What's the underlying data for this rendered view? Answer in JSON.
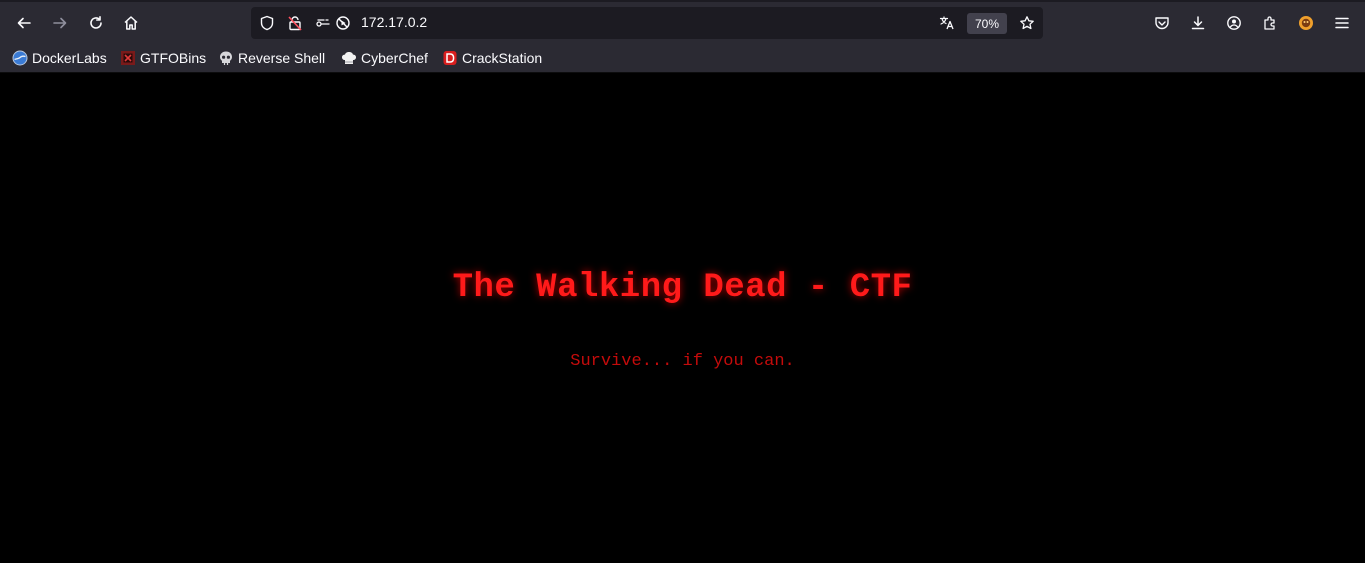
{
  "browser": {
    "url": "172.17.0.2",
    "zoom": "70%"
  },
  "bookmarks": [
    {
      "label": "DockerLabs",
      "icon": "dockerlabs-icon"
    },
    {
      "label": "GTFOBins",
      "icon": "gtfobins-icon"
    },
    {
      "label": "Reverse Shell",
      "icon": "skull-icon"
    },
    {
      "label": "CyberChef",
      "icon": "chef-hat-icon"
    },
    {
      "label": "CrackStation",
      "icon": "crackstation-icon"
    }
  ],
  "page": {
    "title": "The Walking Dead - CTF",
    "subtitle": "Survive... if you can."
  },
  "colors": {
    "toolbar": "#2b2a33",
    "urlbar": "#1c1b22",
    "page_background": "#000000",
    "title": "#ff1a1a",
    "subtitle": "#c40b0b"
  }
}
